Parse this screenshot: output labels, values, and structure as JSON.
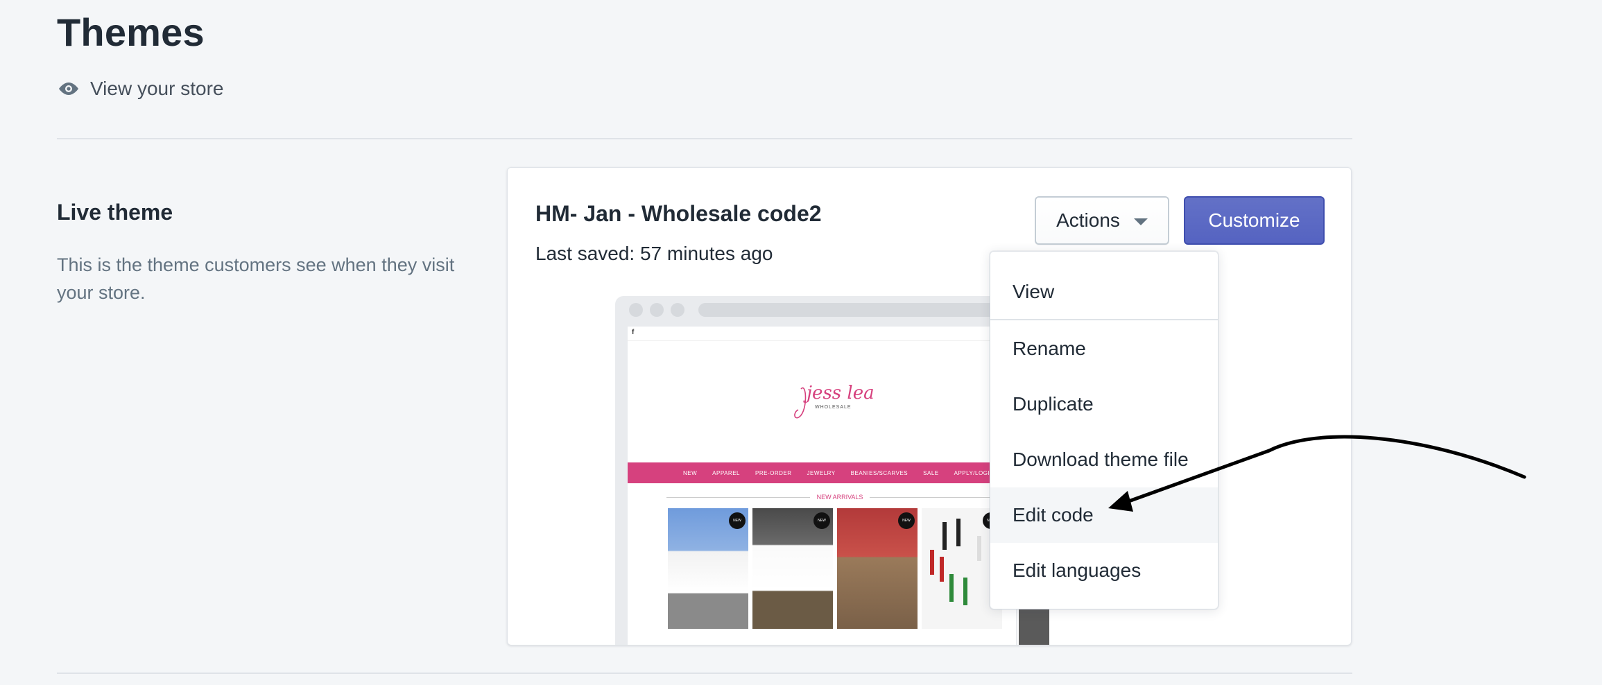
{
  "page": {
    "title": "Themes",
    "view_store": "View your store"
  },
  "section": {
    "title": "Live theme",
    "description": "This is the theme customers see when they visit your store."
  },
  "theme": {
    "name": "HM- Jan - Wholesale code2",
    "last_saved": "Last saved: 57 minutes ago",
    "actions_label": "Actions",
    "customize_label": "Customize"
  },
  "actions_menu": {
    "items": [
      "View",
      "Rename",
      "Duplicate",
      "Download theme file",
      "Edit code",
      "Edit languages"
    ],
    "highlighted": "Edit code"
  },
  "preview": {
    "logo_text": "jess lea",
    "logo_sub": "WHOLESALE",
    "nav": [
      "NEW",
      "APPAREL",
      "PRE-ORDER",
      "JEWELRY",
      "BEANIES/SCARVES",
      "SALE",
      "APPLY/LOGIN FOR WHOLESALE"
    ],
    "section_heading": "NEW ARRIVALS",
    "badge": "NEW"
  },
  "colors": {
    "primary": "#5c6ac4",
    "background": "#f4f6f8",
    "brand_pink": "#d6417e"
  }
}
